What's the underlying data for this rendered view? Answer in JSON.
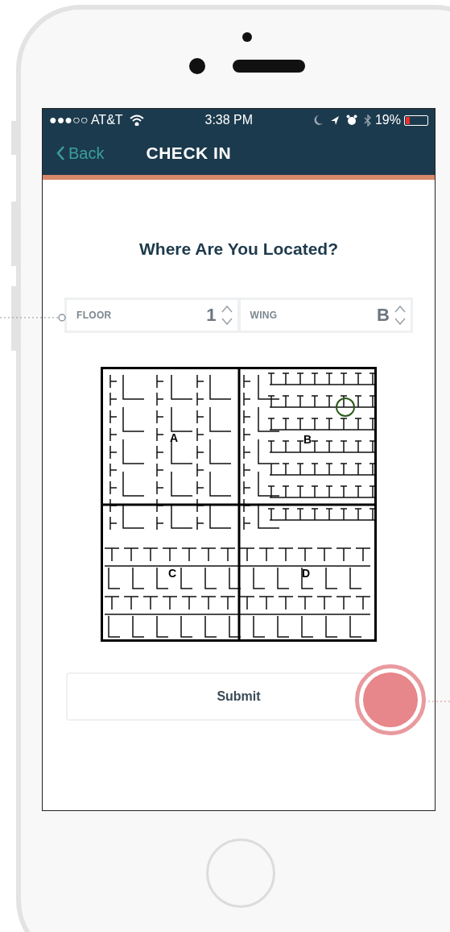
{
  "status_bar": {
    "carrier": "●●●○○ AT&T",
    "time": "3:38 PM",
    "battery": "19%",
    "battery_gauge": {
      "level": 0.19
    }
  },
  "nav_bar": {
    "back": "Back",
    "title": "CHECK IN"
  },
  "heading": "Where Are You Located?",
  "fields": [
    {
      "label": "FLOOR",
      "value": "1"
    },
    {
      "label": "WING",
      "value": "B"
    }
  ],
  "floor_plan": {
    "wings": [
      "A",
      "B",
      "C",
      "D"
    ]
  },
  "submit": "Submit"
}
